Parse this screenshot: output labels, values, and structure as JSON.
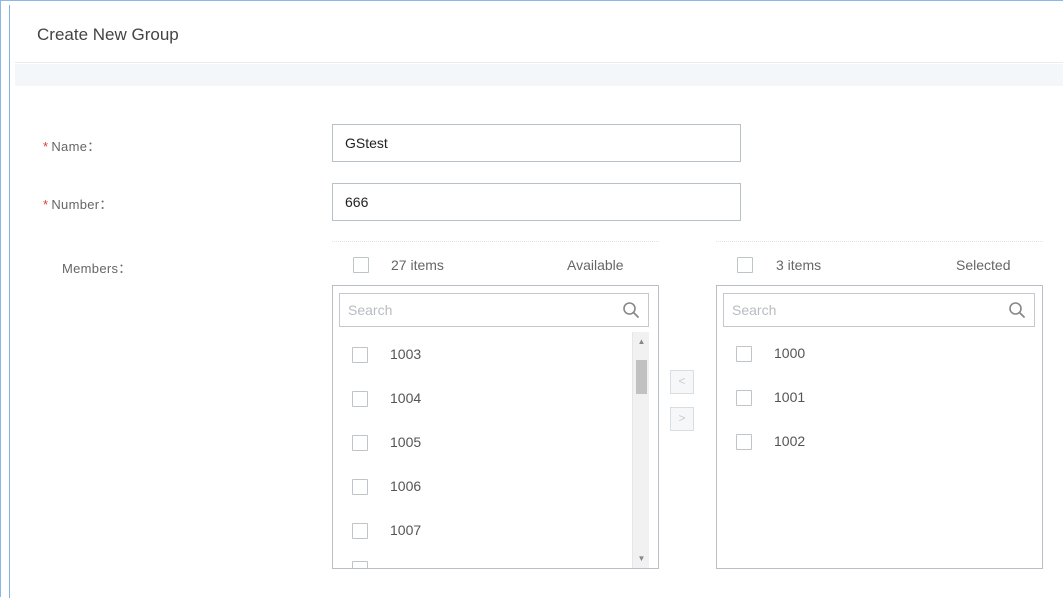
{
  "dialog": {
    "title": "Create New Group"
  },
  "form": {
    "name": {
      "label": "Name：",
      "required_mark": "*",
      "value": "GStest"
    },
    "number": {
      "label": "Number：",
      "required_mark": "*",
      "value": "666"
    },
    "members": {
      "label": "Members："
    }
  },
  "available": {
    "count_text": "27 items",
    "title": "Available",
    "search_placeholder": "Search",
    "items": [
      "1003",
      "1004",
      "1005",
      "1006",
      "1007"
    ]
  },
  "selected": {
    "count_text": "3 items",
    "title": "Selected",
    "search_placeholder": "Search",
    "items": [
      "1000",
      "1001",
      "1002"
    ]
  },
  "transfer": {
    "move_left": "<",
    "move_right": ">"
  },
  "icons": {
    "search": "search-icon",
    "scroll_up": "arrow-up-icon",
    "scroll_down": "arrow-down-icon"
  }
}
